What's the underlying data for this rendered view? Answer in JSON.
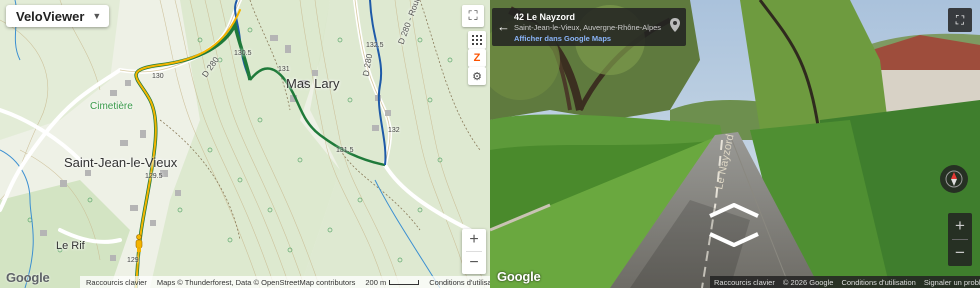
{
  "map": {
    "type_selector": "VeloViewer",
    "labels": {
      "mas_lary": "Mas Lary",
      "saint_jean": "Saint-Jean-le-Vieux",
      "le_rif": "Le Rif",
      "cimetiere": "Cimetière",
      "road_d280_a": "D 280",
      "road_d280_b": "D 280 - Route",
      "road_d280_c": "D 280"
    },
    "elevations": [
      "130.5",
      "130",
      "131",
      "132.5",
      "132",
      "131.5",
      "129.5",
      "129",
      "128"
    ],
    "zoom_in": "+",
    "zoom_out": "−",
    "google": "Google",
    "footer": {
      "shortcuts": "Raccourcis clavier",
      "attribution": "Maps © Thunderforest, Data © OpenStreetMap contributors",
      "scale": "200 m",
      "terms": "Conditions d'utilisation"
    },
    "icons": {
      "fullscreen": "fullscreen-icon",
      "grid": "grid-icon",
      "strava": "strava-icon",
      "settings": "gear-icon"
    }
  },
  "streetview": {
    "address_title": "42 Le Nayzord",
    "address_sub": "Saint-Jean-le-Vieux, Auvergne-Rhône-Alpes",
    "address_link": "Afficher dans Google Maps",
    "road_marking": "Le Nayzord",
    "zoom_in": "+",
    "zoom_out": "−",
    "google": "Google",
    "footer": {
      "shortcuts": "Raccourcis clavier",
      "copyright": "© 2026 Google",
      "terms": "Conditions d'utilisation",
      "report": "Signaler un problème"
    }
  },
  "colors": {
    "route_yellow": "#f4b400",
    "route_green": "#1f7a3a",
    "route_blue": "#1e5aa8",
    "river": "#3b8fd1"
  }
}
